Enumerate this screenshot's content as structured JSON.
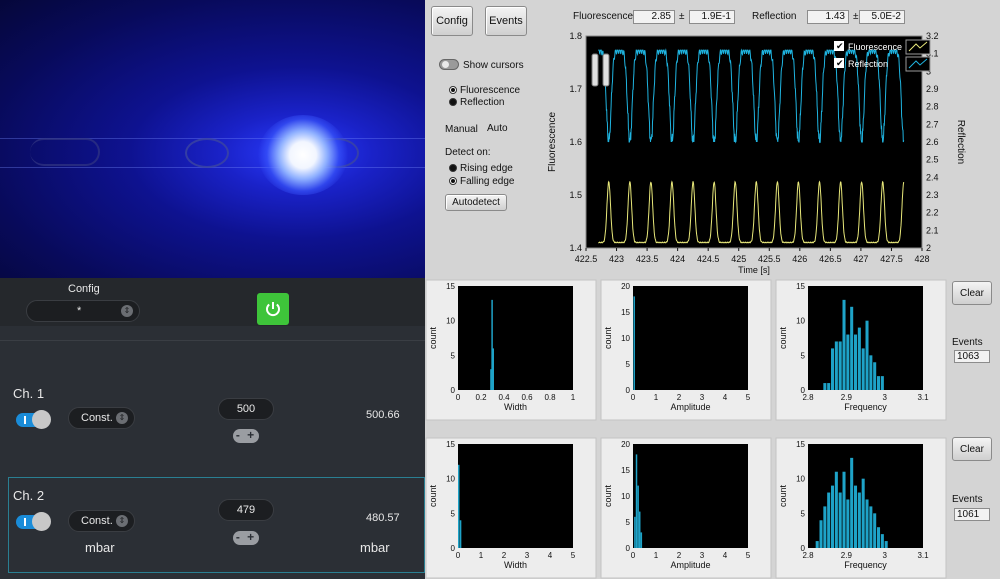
{
  "top_panel": {
    "config_label": "Config",
    "events_label": "Events",
    "fluorescence_label": "Fluorescence",
    "fluorescence_value": "2.85",
    "fluorescence_pm": "±",
    "fluorescence_err": "1.9E-1",
    "reflection_label": "Reflection",
    "reflection_value": "1.43",
    "reflection_pm": "±",
    "reflection_err": "5.0E-2",
    "show_cursors": "Show cursors",
    "radio_fluorescence": "Fluorescence",
    "radio_reflection": "Reflection",
    "manual": "Manual",
    "auto": "Auto",
    "detect_on": "Detect on:",
    "rising_edge": "Rising edge",
    "falling_edge": "Falling edge",
    "autodetect": "Autodetect",
    "legend_fluorescence": "Fluorescence",
    "legend_reflection": "Reflection"
  },
  "pressure": {
    "config_label": "Config",
    "config_value": "*",
    "ch1_label": "Ch. 1",
    "ch1_mode": "Const.",
    "ch1_setpoint": "500",
    "ch1_reading": "500.66",
    "ch2_label": "Ch. 2",
    "ch2_mode": "Const.",
    "ch2_setpoint": "479",
    "ch2_reading": "480.57",
    "unit_left": "mbar",
    "unit_right": "mbar",
    "stepper_glyph": "- +"
  },
  "histograms": {
    "clear_label": "Clear",
    "events_label": "Events",
    "events_row1": "1063",
    "events_row2": "1061"
  },
  "colors": {
    "fluorescence": "#1fb4e0",
    "reflection": "#e8e87a",
    "hist_bar": "#1ea3c8",
    "power_button": "#3ec43a",
    "toggle": "#1a8cd8"
  },
  "icons": {
    "power": "power-icon",
    "updown": "chevron-updown-icon"
  },
  "chart_data": [
    {
      "type": "line",
      "title": "",
      "xlabel": "Time [s]",
      "ylabel": "Fluorescence",
      "ylabel_right": "Reflection",
      "xlim": [
        422.5,
        428
      ],
      "ylim": [
        1.4,
        1.8
      ],
      "ylim_right": [
        2,
        3.2
      ],
      "x_ticks": [
        "422.5",
        "423",
        "423.5",
        "424",
        "424.5",
        "425",
        "425.5",
        "426",
        "426.5",
        "427",
        "427.5",
        "428"
      ],
      "y_ticks": [
        "1.4",
        "1.5",
        "1.6",
        "1.7",
        "1.8"
      ],
      "y_ticks_right": [
        "2",
        "2.1",
        "2.2",
        "2.3",
        "2.4",
        "2.5",
        "2.6",
        "2.7",
        "2.8",
        "2.9",
        "3",
        "3.1",
        "3.2"
      ],
      "legend": "top-right",
      "series": [
        {
          "name": "Fluorescence",
          "axis": "right",
          "period": 0.345,
          "x_start": 422.7,
          "x_end": 427.7,
          "low": 2.6,
          "high": 3.12
        },
        {
          "name": "Reflection",
          "axis": "left",
          "period": 0.345,
          "x_start": 422.7,
          "x_end": 427.7,
          "low": 1.41,
          "high": 1.525
        }
      ]
    },
    {
      "type": "bar",
      "title": "",
      "xlabel": "Width",
      "ylabel": "count",
      "xlim": [
        0,
        1
      ],
      "ylim": [
        0,
        15
      ],
      "x_ticks": [
        "0",
        "0.2",
        "0.4",
        "0.6",
        "0.8",
        "1"
      ],
      "y_ticks": [
        "0",
        "5",
        "10",
        "15"
      ],
      "bins": [
        {
          "x": 0.28,
          "w": 0.01,
          "v": 3
        },
        {
          "x": 0.29,
          "w": 0.01,
          "v": 13
        },
        {
          "x": 0.3,
          "w": 0.01,
          "v": 6
        }
      ]
    },
    {
      "type": "bar",
      "title": "",
      "xlabel": "Amplitude",
      "ylabel": "count",
      "xlim": [
        0,
        5
      ],
      "ylim": [
        0,
        20
      ],
      "x_ticks": [
        "0",
        "1",
        "2",
        "3",
        "4",
        "5"
      ],
      "y_ticks": [
        "0",
        "5",
        "10",
        "15",
        "20"
      ],
      "bins": [
        {
          "x": 0.02,
          "w": 0.06,
          "v": 18
        }
      ]
    },
    {
      "type": "bar",
      "title": "",
      "xlabel": "Frequency",
      "ylabel": "count",
      "xlim": [
        2.8,
        3.1
      ],
      "ylim": [
        0,
        15
      ],
      "x_ticks": [
        "2.8",
        "2.9",
        "3",
        "3.1"
      ],
      "y_ticks": [
        "0",
        "5",
        "10",
        "15"
      ],
      "bins": [
        {
          "x": 2.84,
          "w": 0.01,
          "v": 1
        },
        {
          "x": 2.85,
          "w": 0.01,
          "v": 1
        },
        {
          "x": 2.86,
          "w": 0.01,
          "v": 6
        },
        {
          "x": 2.87,
          "w": 0.01,
          "v": 7
        },
        {
          "x": 2.88,
          "w": 0.01,
          "v": 7
        },
        {
          "x": 2.89,
          "w": 0.01,
          "v": 13
        },
        {
          "x": 2.9,
          "w": 0.01,
          "v": 8
        },
        {
          "x": 2.91,
          "w": 0.01,
          "v": 12
        },
        {
          "x": 2.92,
          "w": 0.01,
          "v": 8
        },
        {
          "x": 2.93,
          "w": 0.01,
          "v": 9
        },
        {
          "x": 2.94,
          "w": 0.01,
          "v": 6
        },
        {
          "x": 2.95,
          "w": 0.01,
          "v": 10
        },
        {
          "x": 2.96,
          "w": 0.01,
          "v": 5
        },
        {
          "x": 2.97,
          "w": 0.01,
          "v": 4
        },
        {
          "x": 2.98,
          "w": 0.01,
          "v": 2
        },
        {
          "x": 2.99,
          "w": 0.01,
          "v": 2
        }
      ]
    },
    {
      "type": "bar",
      "title": "",
      "xlabel": "Width",
      "ylabel": "count",
      "xlim": [
        0,
        5
      ],
      "ylim": [
        0,
        15
      ],
      "x_ticks": [
        "0",
        "1",
        "2",
        "3",
        "4",
        "5"
      ],
      "y_ticks": [
        "0",
        "5",
        "10",
        "15"
      ],
      "bins": [
        {
          "x": 0.0,
          "w": 0.08,
          "v": 12
        },
        {
          "x": 0.08,
          "w": 0.08,
          "v": 4
        }
      ]
    },
    {
      "type": "bar",
      "title": "",
      "xlabel": "Amplitude",
      "ylabel": "count",
      "xlim": [
        0,
        5
      ],
      "ylim": [
        0,
        20
      ],
      "x_ticks": [
        "0",
        "1",
        "2",
        "3",
        "4",
        "5"
      ],
      "y_ticks": [
        "0",
        "5",
        "10",
        "15",
        "20"
      ],
      "bins": [
        {
          "x": 0.05,
          "w": 0.07,
          "v": 6
        },
        {
          "x": 0.12,
          "w": 0.07,
          "v": 18
        },
        {
          "x": 0.19,
          "w": 0.07,
          "v": 12
        },
        {
          "x": 0.26,
          "w": 0.07,
          "v": 7
        },
        {
          "x": 0.33,
          "w": 0.07,
          "v": 3
        }
      ]
    },
    {
      "type": "bar",
      "title": "",
      "xlabel": "Frequency",
      "ylabel": "count",
      "xlim": [
        2.8,
        3.1
      ],
      "ylim": [
        0,
        15
      ],
      "x_ticks": [
        "2.8",
        "2.9",
        "3",
        "3.1"
      ],
      "y_ticks": [
        "0",
        "5",
        "10",
        "15"
      ],
      "bins": [
        {
          "x": 2.82,
          "w": 0.01,
          "v": 1
        },
        {
          "x": 2.83,
          "w": 0.01,
          "v": 4
        },
        {
          "x": 2.84,
          "w": 0.01,
          "v": 6
        },
        {
          "x": 2.85,
          "w": 0.01,
          "v": 8
        },
        {
          "x": 2.86,
          "w": 0.01,
          "v": 9
        },
        {
          "x": 2.87,
          "w": 0.01,
          "v": 11
        },
        {
          "x": 2.88,
          "w": 0.01,
          "v": 8
        },
        {
          "x": 2.89,
          "w": 0.01,
          "v": 11
        },
        {
          "x": 2.9,
          "w": 0.01,
          "v": 7
        },
        {
          "x": 2.91,
          "w": 0.01,
          "v": 13
        },
        {
          "x": 2.92,
          "w": 0.01,
          "v": 9
        },
        {
          "x": 2.93,
          "w": 0.01,
          "v": 8
        },
        {
          "x": 2.94,
          "w": 0.01,
          "v": 10
        },
        {
          "x": 2.95,
          "w": 0.01,
          "v": 7
        },
        {
          "x": 2.96,
          "w": 0.01,
          "v": 6
        },
        {
          "x": 2.97,
          "w": 0.01,
          "v": 5
        },
        {
          "x": 2.98,
          "w": 0.01,
          "v": 3
        },
        {
          "x": 2.99,
          "w": 0.01,
          "v": 2
        },
        {
          "x": 3.0,
          "w": 0.01,
          "v": 1
        }
      ]
    }
  ]
}
